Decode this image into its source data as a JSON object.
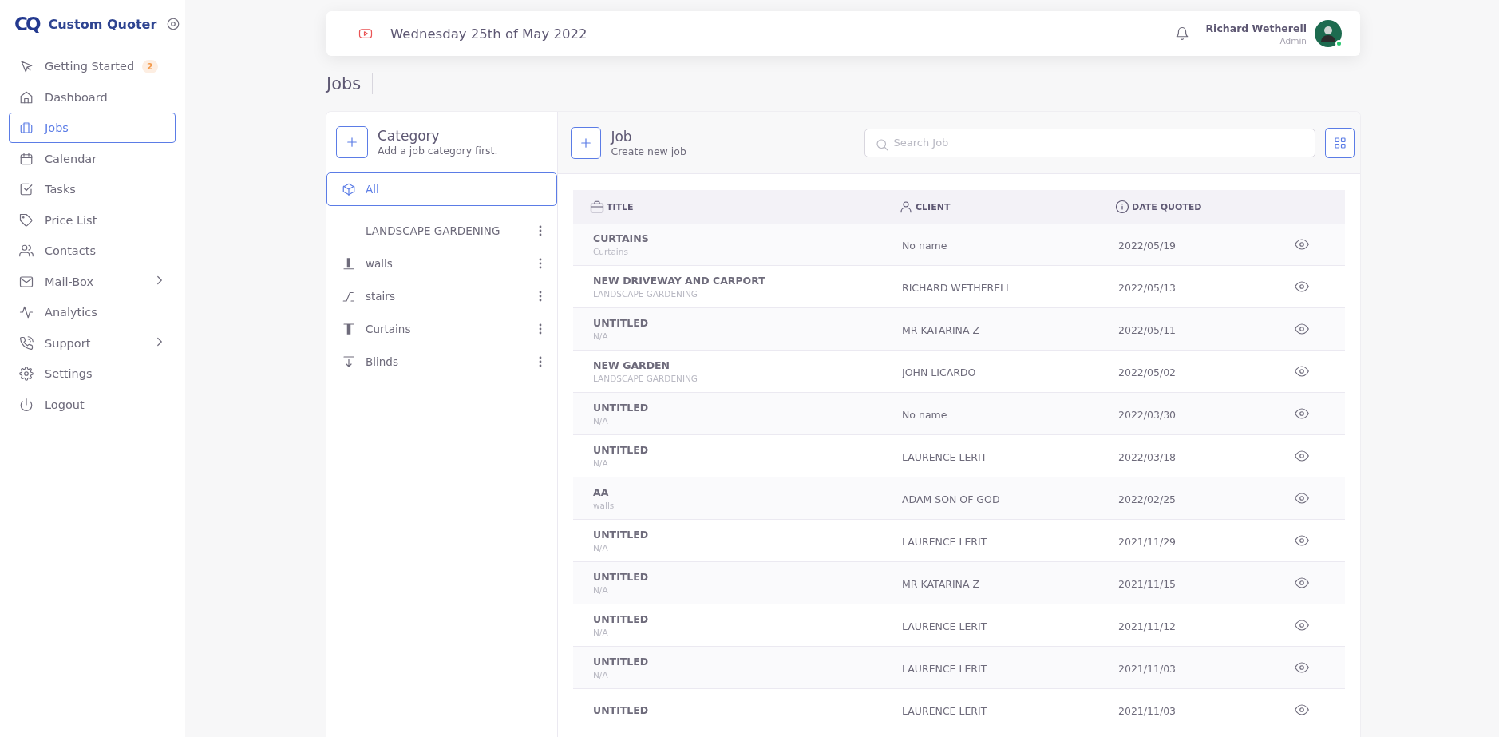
{
  "sidebar": {
    "logo": "CQ",
    "app_name": "Custom Quoter",
    "items": [
      {
        "label": "Getting Started",
        "badge": "2",
        "selected": false,
        "has_submenu": false
      },
      {
        "label": "Dashboard",
        "selected": false,
        "has_submenu": false
      },
      {
        "label": "Jobs",
        "selected": true,
        "has_submenu": false
      },
      {
        "label": "Calendar",
        "selected": false,
        "has_submenu": false
      },
      {
        "label": "Tasks",
        "selected": false,
        "has_submenu": false
      },
      {
        "label": "Price List",
        "selected": false,
        "has_submenu": false
      },
      {
        "label": "Contacts",
        "selected": false,
        "has_submenu": false
      },
      {
        "label": "Mail-Box",
        "selected": false,
        "has_submenu": true
      },
      {
        "label": "Analytics",
        "selected": false,
        "has_submenu": false
      },
      {
        "label": "Support",
        "selected": false,
        "has_submenu": true
      },
      {
        "label": "Settings",
        "selected": false,
        "has_submenu": false
      },
      {
        "label": "Logout",
        "selected": false,
        "has_submenu": false
      }
    ]
  },
  "header": {
    "date": "Wednesday 25th of May 2022",
    "user": {
      "name": "Richard Wetherell",
      "role": "Admin",
      "online": true
    }
  },
  "page_title": "Jobs",
  "category_panel": {
    "title": "Category",
    "subtitle": "Add a job category first.",
    "items": [
      {
        "label": "All",
        "selected": true,
        "has_menu": false
      },
      {
        "label": "LANDSCAPE GARDENING",
        "selected": false,
        "has_menu": true
      },
      {
        "label": "walls",
        "selected": false,
        "has_menu": true
      },
      {
        "label": "stairs",
        "selected": false,
        "has_menu": true
      },
      {
        "label": "Curtains",
        "selected": false,
        "has_menu": true
      },
      {
        "label": "Blinds",
        "selected": false,
        "has_menu": true
      }
    ]
  },
  "job_panel": {
    "title": "Job",
    "subtitle": "Create new job",
    "search": {
      "placeholder": "Search Job"
    },
    "table": {
      "columns": [
        {
          "label": "TITLE"
        },
        {
          "label": "CLIENT"
        },
        {
          "label": "DATE QUOTED"
        }
      ],
      "rows": [
        {
          "title": "CURTAINS",
          "subtitle": "Curtains",
          "client": "No name",
          "date": "2022/05/19"
        },
        {
          "title": "NEW DRIVEWAY AND CARPORT",
          "subtitle": "LANDSCAPE GARDENING",
          "client": "RICHARD WETHERELL",
          "date": "2022/05/13"
        },
        {
          "title": "UNTITLED",
          "subtitle": "N/A",
          "client": "MR KATARINA Z",
          "date": "2022/05/11"
        },
        {
          "title": "NEW GARDEN",
          "subtitle": "LANDSCAPE GARDENING",
          "client": "JOHN LICARDO",
          "date": "2022/05/02"
        },
        {
          "title": "UNTITLED",
          "subtitle": "N/A",
          "client": "No name",
          "date": "2022/03/30"
        },
        {
          "title": "UNTITLED",
          "subtitle": "N/A",
          "client": "LAURENCE LERIT",
          "date": "2022/03/18"
        },
        {
          "title": "AA",
          "subtitle": "walls",
          "client": "ADAM SON OF GOD",
          "date": "2022/02/25"
        },
        {
          "title": "UNTITLED",
          "subtitle": "N/A",
          "client": "LAURENCE LERIT",
          "date": "2021/11/29"
        },
        {
          "title": "UNTITLED",
          "subtitle": "N/A",
          "client": "MR KATARINA Z",
          "date": "2021/11/15"
        },
        {
          "title": "UNTITLED",
          "subtitle": "N/A",
          "client": "LAURENCE LERIT",
          "date": "2021/11/12"
        },
        {
          "title": "UNTITLED",
          "subtitle": "N/A",
          "client": "LAURENCE LERIT",
          "date": "2021/11/03"
        },
        {
          "title": "UNTITLED",
          "client": "LAURENCE LERIT",
          "date": "2021/11/03"
        }
      ]
    }
  }
}
